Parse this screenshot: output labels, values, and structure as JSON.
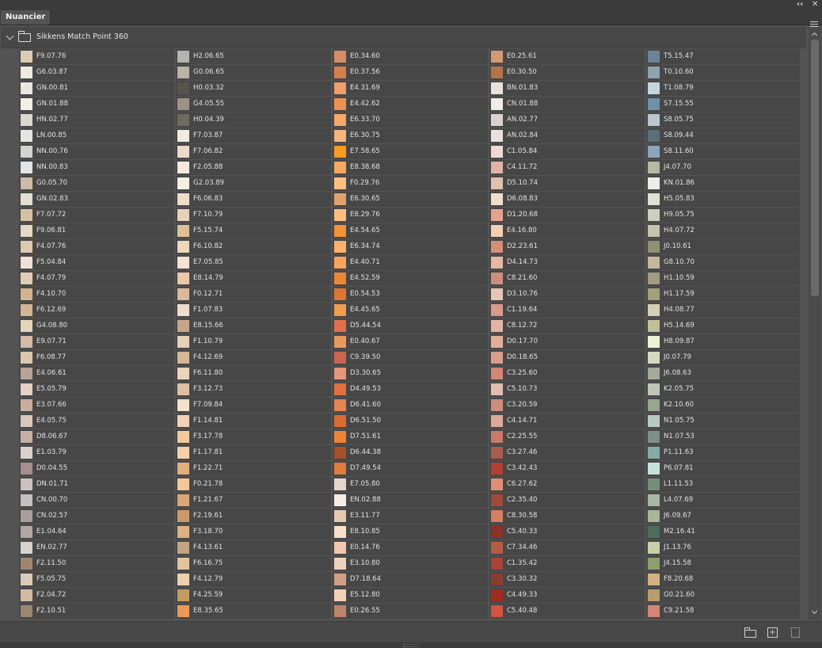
{
  "panel": {
    "tab_label": "Nuancier",
    "collapse_glyph": "‹‹",
    "close_glyph": "✕"
  },
  "group": {
    "name": "Sikkens Match Point 360"
  },
  "footer": {
    "new_swatch_glyph": "+"
  },
  "columns": [
    [
      {
        "name": "F9.07.76",
        "color": "#dccab3"
      },
      {
        "name": "G6.03.87",
        "color": "#efeadf"
      },
      {
        "name": "GN.00.81",
        "color": "#e9e7e0"
      },
      {
        "name": "GN.01.88",
        "color": "#f1efe6"
      },
      {
        "name": "HN.02.77",
        "color": "#dad9cf"
      },
      {
        "name": "LN.00.85",
        "color": "#e5e5e3"
      },
      {
        "name": "NN.00.76",
        "color": "#d3d3d2"
      },
      {
        "name": "NN.00.83",
        "color": "#e2e4e5"
      },
      {
        "name": "G0.05.70",
        "color": "#ccbca9"
      },
      {
        "name": "GN.02.83",
        "color": "#e2dfd2"
      },
      {
        "name": "F7.07.72",
        "color": "#d4c0a8"
      },
      {
        "name": "F9.06.81",
        "color": "#e6d8c4"
      },
      {
        "name": "F4.07.76",
        "color": "#dfc8b2"
      },
      {
        "name": "F5.04.84",
        "color": "#efe2d4"
      },
      {
        "name": "F4.07.79",
        "color": "#e3ccb4"
      },
      {
        "name": "F4.10.70",
        "color": "#d4b18f"
      },
      {
        "name": "F6.12.69",
        "color": "#d2b594"
      },
      {
        "name": "G4.08.80",
        "color": "#e4d6bd"
      },
      {
        "name": "E9.07.71",
        "color": "#d4bba8"
      },
      {
        "name": "F6.08.77",
        "color": "#dcc7ae"
      },
      {
        "name": "E4.06.61",
        "color": "#b7a496"
      },
      {
        "name": "E5.05.79",
        "color": "#e4d1c5"
      },
      {
        "name": "E3.07.66",
        "color": "#c8ad9e"
      },
      {
        "name": "E4.05.75",
        "color": "#d9c7bb"
      },
      {
        "name": "D8.06.67",
        "color": "#c6aea6"
      },
      {
        "name": "E1.03.79",
        "color": "#ddd1cb"
      },
      {
        "name": "D0.04.55",
        "color": "#a48f8c"
      },
      {
        "name": "DN.01.71",
        "color": "#cbc2bf"
      },
      {
        "name": "CN.00.70",
        "color": "#c4c0bf"
      },
      {
        "name": "CN.02.57",
        "color": "#a89f9d"
      },
      {
        "name": "E1.04.64",
        "color": "#b5a69f"
      },
      {
        "name": "EN.02.77",
        "color": "#d9d1cc"
      },
      {
        "name": "F2.11.50",
        "color": "#9f8571"
      },
      {
        "name": "F5.05.75",
        "color": "#dacab8"
      },
      {
        "name": "F2.04.72",
        "color": "#d1bba2"
      },
      {
        "name": "F2.10.51",
        "color": "#9e8674"
      }
    ],
    [
      {
        "name": "H2.06.65",
        "color": "#b3b5ae"
      },
      {
        "name": "G0.06.65",
        "color": "#bab3a6"
      },
      {
        "name": "H0.03.32",
        "color": "#56544c"
      },
      {
        "name": "G4.05.55",
        "color": "#9c9383"
      },
      {
        "name": "H0.04.39",
        "color": "#6d6a5f"
      },
      {
        "name": "F7.03.87",
        "color": "#f3ebe0"
      },
      {
        "name": "F7.06.82",
        "color": "#ecdac8"
      },
      {
        "name": "F2.05.88",
        "color": "#fbeadb"
      },
      {
        "name": "G2.03.89",
        "color": "#f6efe2"
      },
      {
        "name": "F6.06.83",
        "color": "#ecdcc8"
      },
      {
        "name": "F7.10.79",
        "color": "#e6d2b8"
      },
      {
        "name": "F5.15.74",
        "color": "#dfbf97"
      },
      {
        "name": "F6.10.82",
        "color": "#eed8bb"
      },
      {
        "name": "E7.05.85",
        "color": "#f3e1d4"
      },
      {
        "name": "E8.14.79",
        "color": "#ecc8ab"
      },
      {
        "name": "F0.12.71",
        "color": "#dab89d"
      },
      {
        "name": "F1.07.83",
        "color": "#f0dccc"
      },
      {
        "name": "E8.15.66",
        "color": "#cba589"
      },
      {
        "name": "F1.10.79",
        "color": "#e8cfb8"
      },
      {
        "name": "F4.12.69",
        "color": "#d5b796"
      },
      {
        "name": "F6.11.80",
        "color": "#ead6bc"
      },
      {
        "name": "F3.12.73",
        "color": "#ddc0a2"
      },
      {
        "name": "F7.09.84",
        "color": "#f4e1c8"
      },
      {
        "name": "F1.14.81",
        "color": "#f2d2b4"
      },
      {
        "name": "F3.17.78",
        "color": "#f0c99d"
      },
      {
        "name": "F1.17.81",
        "color": "#f6d0a9"
      },
      {
        "name": "F1.22.71",
        "color": "#e2ae7e"
      },
      {
        "name": "F0.21.78",
        "color": "#f3c798"
      },
      {
        "name": "F1.21.67",
        "color": "#dba678"
      },
      {
        "name": "F2.19.61",
        "color": "#c9996c"
      },
      {
        "name": "F3.18.70",
        "color": "#ddb287"
      },
      {
        "name": "F4.13.61",
        "color": "#c3a584"
      },
      {
        "name": "F6.16.75",
        "color": "#e2c49d"
      },
      {
        "name": "F4.12.79",
        "color": "#ebd0b1"
      },
      {
        "name": "F4.25.59",
        "color": "#c49b63"
      },
      {
        "name": "E8.35.65",
        "color": "#eb9a5c"
      }
    ],
    [
      {
        "name": "E0.34.60",
        "color": "#d88c67"
      },
      {
        "name": "E0.37.56",
        "color": "#d3804f"
      },
      {
        "name": "E4.31.69",
        "color": "#ec9f68"
      },
      {
        "name": "E4.42.62",
        "color": "#ed9152"
      },
      {
        "name": "E6.33.70",
        "color": "#f4a96b"
      },
      {
        "name": "E6.30.75",
        "color": "#f6b47d"
      },
      {
        "name": "E7.58.65",
        "color": "#f89b1e"
      },
      {
        "name": "E8.38.68",
        "color": "#f5a862"
      },
      {
        "name": "F0.29.76",
        "color": "#fbc07f"
      },
      {
        "name": "E6.30.65",
        "color": "#e2a16d"
      },
      {
        "name": "E8.29.76",
        "color": "#fbbe7c"
      },
      {
        "name": "E4.54.65",
        "color": "#f49238"
      },
      {
        "name": "E6.34.74",
        "color": "#fbb26f"
      },
      {
        "name": "E4.40.71",
        "color": "#f5a35d"
      },
      {
        "name": "E4.52.59",
        "color": "#ea8833"
      },
      {
        "name": "E0.54.53",
        "color": "#df7530"
      },
      {
        "name": "E4.45.65",
        "color": "#f19d4e"
      },
      {
        "name": "D5.44.54",
        "color": "#e0704a"
      },
      {
        "name": "E0.40.67",
        "color": "#e89a5c"
      },
      {
        "name": "C9.39.50",
        "color": "#cd6452"
      },
      {
        "name": "D3.30.65",
        "color": "#e6967b"
      },
      {
        "name": "D4.49.53",
        "color": "#e0703f"
      },
      {
        "name": "D6.41.60",
        "color": "#e68455"
      },
      {
        "name": "D6.51.50",
        "color": "#d96c32"
      },
      {
        "name": "D7.51.61",
        "color": "#ec8538"
      },
      {
        "name": "D6.44.38",
        "color": "#a7502a"
      },
      {
        "name": "D7.49.54",
        "color": "#e07b3a"
      },
      {
        "name": "E7.05.80",
        "color": "#e8d6c9"
      },
      {
        "name": "EN.02.88",
        "color": "#f5ede6"
      },
      {
        "name": "E3.11.77",
        "color": "#e6c7b2"
      },
      {
        "name": "E8.10.85",
        "color": "#f7e1ce"
      },
      {
        "name": "E0.14.76",
        "color": "#f3c7ae"
      },
      {
        "name": "E3.10.80",
        "color": "#efd3bd"
      },
      {
        "name": "D7.18.64",
        "color": "#d39f88"
      },
      {
        "name": "E5.12.80",
        "color": "#f3d1b6"
      },
      {
        "name": "E0.26.55",
        "color": "#be8666"
      }
    ],
    [
      {
        "name": "E0.25.61",
        "color": "#d39a74"
      },
      {
        "name": "E0.30.50",
        "color": "#b67349"
      },
      {
        "name": "BN.01.83",
        "color": "#ebe1dc"
      },
      {
        "name": "CN.01.88",
        "color": "#f2ebe7"
      },
      {
        "name": "AN.02.77",
        "color": "#dccfcf"
      },
      {
        "name": "AN.02.84",
        "color": "#eddfdd"
      },
      {
        "name": "C1.05.84",
        "color": "#f1d9d2"
      },
      {
        "name": "C4.11.72",
        "color": "#e0b4a5"
      },
      {
        "name": "D5.10.74",
        "color": "#e1c2ac"
      },
      {
        "name": "D6.08.83",
        "color": "#f1dccc"
      },
      {
        "name": "D1.20.68",
        "color": "#e4a38c"
      },
      {
        "name": "E4.16.80",
        "color": "#f5cfb3"
      },
      {
        "name": "D2.23.61",
        "color": "#d48f76"
      },
      {
        "name": "D4.14.73",
        "color": "#e7b8a1"
      },
      {
        "name": "C8.21.60",
        "color": "#d08c7d"
      },
      {
        "name": "D3.10.76",
        "color": "#e7c6b6"
      },
      {
        "name": "C1.19.64",
        "color": "#d9998b"
      },
      {
        "name": "C8.12.72",
        "color": "#e2b4a5"
      },
      {
        "name": "D0.17.70",
        "color": "#e3ae98"
      },
      {
        "name": "D0.18.65",
        "color": "#d99f8c"
      },
      {
        "name": "C3.25.60",
        "color": "#d48573"
      },
      {
        "name": "C5.10.73",
        "color": "#e2bcae"
      },
      {
        "name": "C3.20.59",
        "color": "#cd8c7d"
      },
      {
        "name": "C4.14.71",
        "color": "#dea99a"
      },
      {
        "name": "C2.25.55",
        "color": "#c97a6b"
      },
      {
        "name": "C3.27.46",
        "color": "#a95c4c"
      },
      {
        "name": "C3.42.43",
        "color": "#b43e34"
      },
      {
        "name": "C6.27.62",
        "color": "#e08f76"
      },
      {
        "name": "C2.35.40",
        "color": "#a24838"
      },
      {
        "name": "C8.30.58",
        "color": "#d87e63"
      },
      {
        "name": "C5.40.33",
        "color": "#8c3226"
      },
      {
        "name": "C7.34.46",
        "color": "#b45b45"
      },
      {
        "name": "C1.35.42",
        "color": "#a8443b"
      },
      {
        "name": "C3.30.32",
        "color": "#883d31"
      },
      {
        "name": "C4.49.33",
        "color": "#a02b22"
      },
      {
        "name": "C5.40.48",
        "color": "#d0543f"
      }
    ],
    [
      {
        "name": "T5.15.47",
        "color": "#6c8499"
      },
      {
        "name": "T0.10.60",
        "color": "#8ea2b0"
      },
      {
        "name": "T1.08.79",
        "color": "#c4d6e2"
      },
      {
        "name": "S7.15.55",
        "color": "#6f91a8"
      },
      {
        "name": "S8.05.75",
        "color": "#b9c6cf"
      },
      {
        "name": "S8.09.44",
        "color": "#5b6f7a"
      },
      {
        "name": "S8.11.60",
        "color": "#8ba5b6"
      },
      {
        "name": "J4.07.70",
        "color": "#b3b9a2"
      },
      {
        "name": "KN.01.86",
        "color": "#eaeee6"
      },
      {
        "name": "H5.05.83",
        "color": "#e1e2d2"
      },
      {
        "name": "H9.05.75",
        "color": "#cccfbc"
      },
      {
        "name": "H4.07.72",
        "color": "#c5c3ad"
      },
      {
        "name": "J0.10.61",
        "color": "#8e8f73"
      },
      {
        "name": "G8.10.70",
        "color": "#c4b89c"
      },
      {
        "name": "H1.10.59",
        "color": "#a19c82"
      },
      {
        "name": "H1.17.59",
        "color": "#a29f7b"
      },
      {
        "name": "H4.08.77",
        "color": "#d2cfb6"
      },
      {
        "name": "H5.14.69",
        "color": "#c0bf98"
      },
      {
        "name": "H8.09.87",
        "color": "#eff1d6"
      },
      {
        "name": "J0.07.79",
        "color": "#d5d9c2"
      },
      {
        "name": "J6.08.63",
        "color": "#a3ab99"
      },
      {
        "name": "K2.05.75",
        "color": "#bfc7b9"
      },
      {
        "name": "K2.10.60",
        "color": "#96a68f"
      },
      {
        "name": "N1.05.75",
        "color": "#b8c9c2"
      },
      {
        "name": "N1.07.53",
        "color": "#7c8f88"
      },
      {
        "name": "P1.11.63",
        "color": "#86aba6"
      },
      {
        "name": "P6.07.81",
        "color": "#c8e0db"
      },
      {
        "name": "L1.11.53",
        "color": "#738f77"
      },
      {
        "name": "L4.07.69",
        "color": "#a6b8a4"
      },
      {
        "name": "J6.09.67",
        "color": "#a8b597"
      },
      {
        "name": "M2.16.41",
        "color": "#4d6e5b"
      },
      {
        "name": "J1.13.76",
        "color": "#c7d1a9"
      },
      {
        "name": "J4.15.58",
        "color": "#8e9e6d"
      },
      {
        "name": "F8.20.68",
        "color": "#d3b282"
      },
      {
        "name": "G0.21.60",
        "color": "#b69d6a"
      },
      {
        "name": "C9.21.58",
        "color": "#d18776"
      }
    ]
  ]
}
